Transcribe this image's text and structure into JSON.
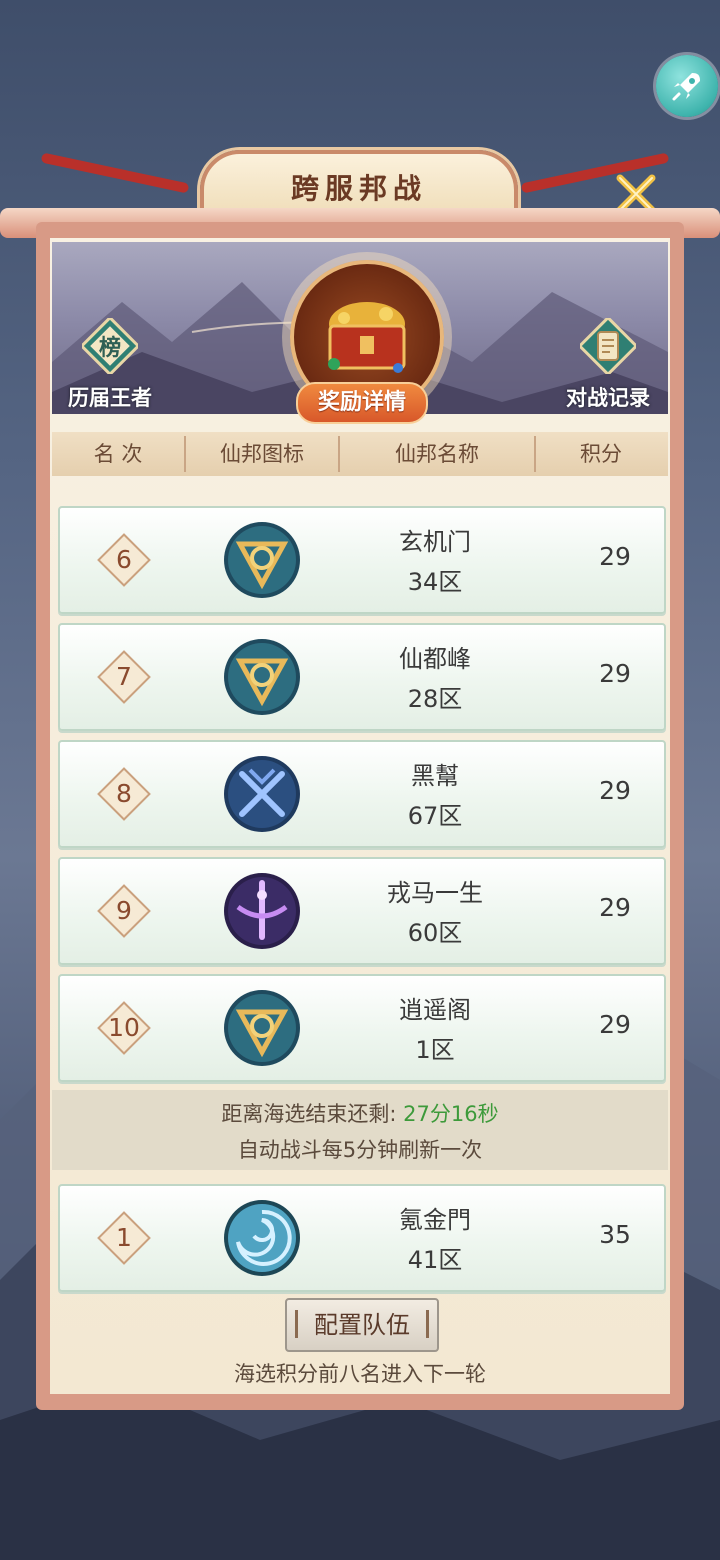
{
  "title": "跨服邦战",
  "side_buttons": {
    "left_icon_char": "榜",
    "left_label": "历届王者",
    "right_label": "对战记录"
  },
  "reward_label": "奖励详情",
  "table_headers": [
    "名 次",
    "仙邦图标",
    "仙邦名称",
    "积分"
  ],
  "rows": [
    {
      "rank": "6",
      "name": "玄机门",
      "server": "34区",
      "score": "29",
      "emblem": "gold-swirl-emblem"
    },
    {
      "rank": "7",
      "name": "仙都峰",
      "server": "28区",
      "score": "29",
      "emblem": "gold-swirl-emblem"
    },
    {
      "rank": "8",
      "name": "黑幫",
      "server": "67区",
      "score": "29",
      "emblem": "blue-crossed-swords-emblem"
    },
    {
      "rank": "9",
      "name": "戎马一生",
      "server": "60区",
      "score": "29",
      "emblem": "purple-sword-emblem"
    },
    {
      "rank": "10",
      "name": "逍遥阁",
      "server": "1区",
      "score": "29",
      "emblem": "gold-swirl-emblem"
    }
  ],
  "timer": {
    "prefix": "距离海选结束还剩:",
    "value": "27分16秒",
    "note": "自动战斗每5分钟刷新一次"
  },
  "my_row": {
    "rank": "1",
    "name": "氪金門",
    "server": "41区",
    "score": "35",
    "emblem": "teal-vortex-emblem"
  },
  "config_button": "配置队伍",
  "footer_note": "海选积分前八名进入下一轮",
  "colors": {
    "accent_green": "#3d9a3a",
    "panel_border": "#d89a86",
    "ribbon_red": "#b9302a"
  }
}
